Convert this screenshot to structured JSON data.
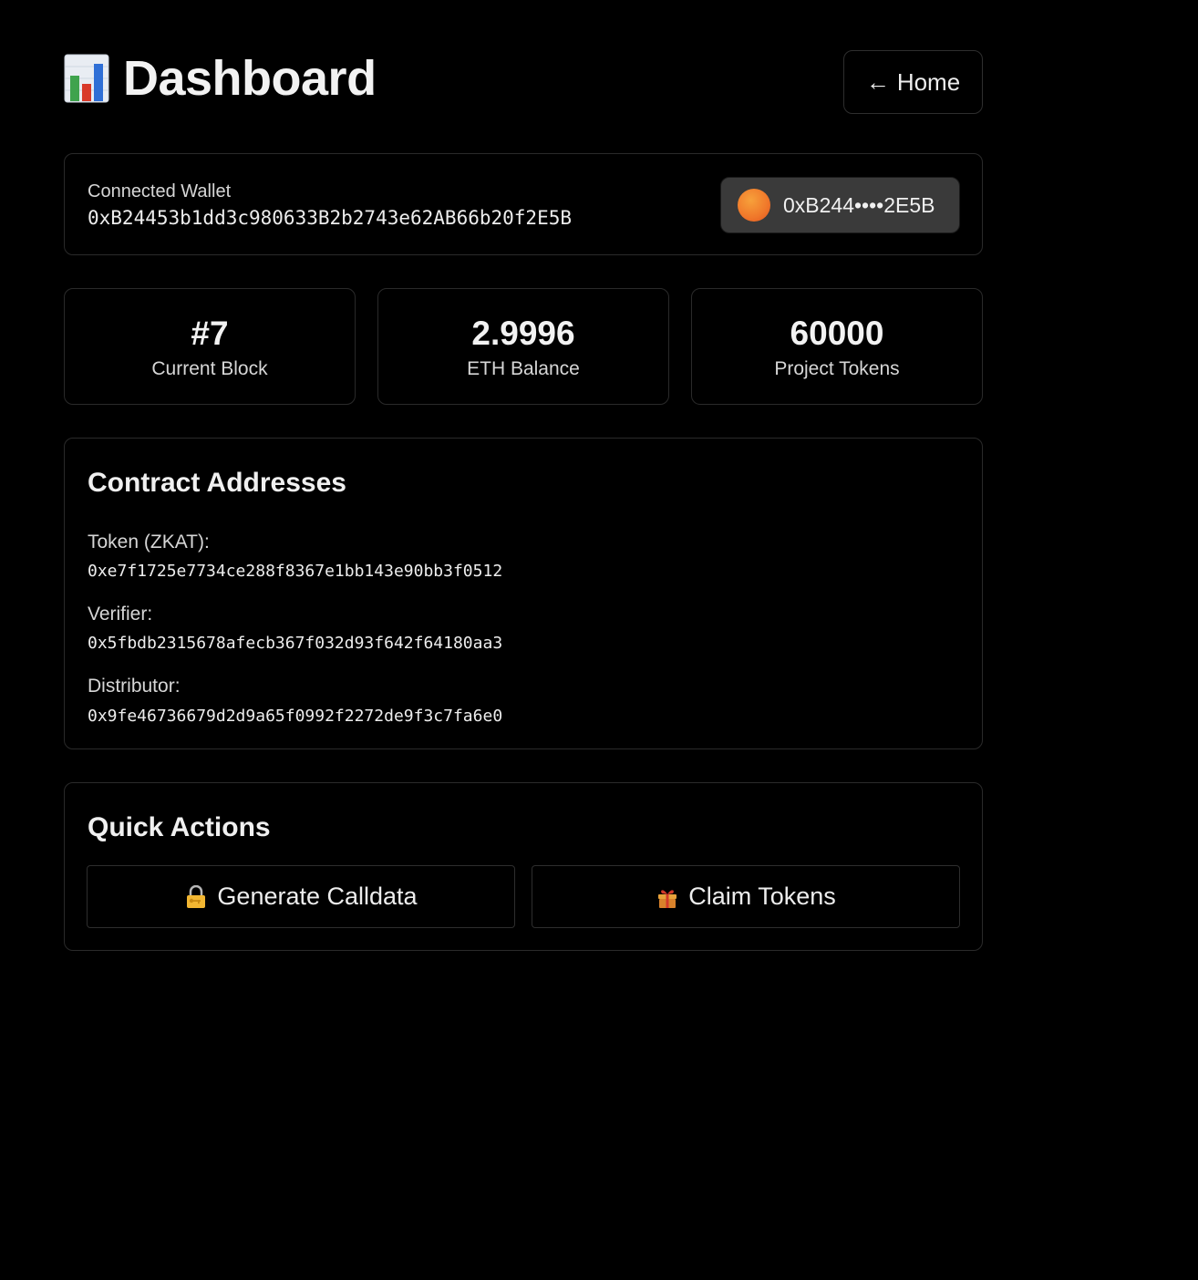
{
  "header": {
    "title": "Dashboard",
    "home_label": "Home",
    "home_arrow": "←"
  },
  "wallet": {
    "label": "Connected Wallet",
    "address": "0xB24453b1dd3c980633B2b2743e62AB66b20f2E5B",
    "chip_text": "0xB244••••2E5B"
  },
  "stats": [
    {
      "value": "#7",
      "label": "Current Block"
    },
    {
      "value": "2.9996",
      "label": "ETH Balance"
    },
    {
      "value": "60000",
      "label": "Project Tokens"
    }
  ],
  "contracts": {
    "title": "Contract Addresses",
    "items": [
      {
        "label": "Token (ZKAT):",
        "address": "0xe7f1725e7734ce288f8367e1bb143e90bb3f0512"
      },
      {
        "label": "Verifier:",
        "address": "0x5fbdb2315678afecb367f032d93f642f64180aa3"
      },
      {
        "label": "Distributor:",
        "address": "0x9fe46736679d2d9a65f0992f2272de9f3c7fa6e0"
      }
    ]
  },
  "actions": {
    "title": "Quick Actions",
    "generate_label": "Generate Calldata",
    "claim_label": "Claim Tokens"
  },
  "colors": {
    "background": "#000000",
    "border": "#2a2a2a",
    "chip_bg": "#3a3a3a",
    "avatar": "#f0772a"
  },
  "icons": {
    "title": "bar-chart-icon",
    "home": "arrow-left-icon",
    "generate": "lock-key-icon",
    "claim": "gift-icon",
    "wallet": "wallet-avatar-icon"
  }
}
